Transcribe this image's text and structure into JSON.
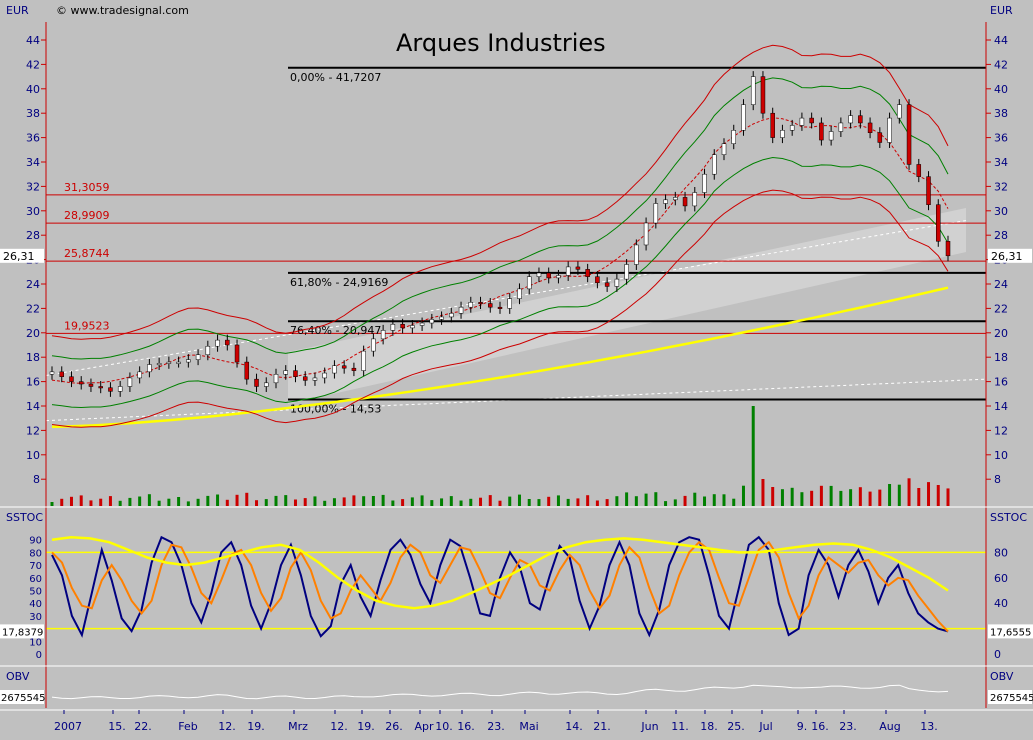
{
  "header": {
    "currency_left": "EUR",
    "currency_right": "EUR",
    "source": "© www.tradesignal.com",
    "title": "Arques Industries"
  },
  "colors": {
    "background": "#c0c0c0",
    "price_axis_line": "#cc0000",
    "fib_line": "#000000",
    "retrace_line": "#cc0000",
    "candle_up": "#ffffff",
    "candle_down": "#cc0000",
    "volume_up": "#008000",
    "volume_down": "#cc0000",
    "bollinger_outer": "#cc0000",
    "bollinger_inner": "#008000",
    "moving_average": "#ffff00",
    "stoch_fast": "#000080",
    "stoch_slow": "#ff8000",
    "obv": "#ffffff"
  },
  "chart_data": [
    {
      "panel": "price",
      "type": "candlestick",
      "title": "Arques Industries",
      "ylabel": "EUR",
      "ylim": [
        6,
        46
      ],
      "y_ticks": [
        8,
        10,
        12,
        14,
        16,
        18,
        20,
        22,
        24,
        26,
        28,
        30,
        32,
        34,
        36,
        38,
        40,
        42,
        44
      ],
      "grid": false,
      "last_price": "26,31",
      "x_labels": [
        "2007",
        "15.",
        "22.",
        "Feb",
        "12.",
        "19.",
        "Mrz",
        "12.",
        "19.",
        "26.",
        "Apr",
        "10.",
        "16.",
        "23.",
        "Mai",
        "14.",
        "21.",
        "Jun",
        "11.",
        "18.",
        "25.",
        "Jul",
        "9.",
        "16.",
        "23.",
        "Aug",
        "13."
      ],
      "fibonacci_levels": [
        {
          "label": "0,00% - 41,7207",
          "value": 41.7207
        },
        {
          "label": "61,80% - 24,9169",
          "value": 24.9169
        },
        {
          "label": "76,40% - 20,947",
          "value": 20.947
        },
        {
          "label": "100,00% - 14,53",
          "value": 14.53
        }
      ],
      "horizontal_levels": [
        {
          "label": "31,3059",
          "value": 31.3059
        },
        {
          "label": "28,9909",
          "value": 28.9909
        },
        {
          "label": "25,8744",
          "value": 25.8744
        },
        {
          "label": "19,9523",
          "value": 19.9523
        }
      ],
      "close_series_approx": [
        16.8,
        16.4,
        16.0,
        15.8,
        15.6,
        15.5,
        15.2,
        15.6,
        16.3,
        16.8,
        17.4,
        17.5,
        17.6,
        17.6,
        17.8,
        18.2,
        18.9,
        19.4,
        19.0,
        17.6,
        16.2,
        15.6,
        15.9,
        16.6,
        16.9,
        16.4,
        16.1,
        16.3,
        16.7,
        17.3,
        17.1,
        16.9,
        18.5,
        19.5,
        20.2,
        20.7,
        20.4,
        20.6,
        20.8,
        21.1,
        21.3,
        21.6,
        22.1,
        22.5,
        22.4,
        22.1,
        22.0,
        22.8,
        23.6,
        24.6,
        24.9,
        24.5,
        24.7,
        25.4,
        25.2,
        24.6,
        24.1,
        23.8,
        24.4,
        25.6,
        27.2,
        29.0,
        30.6,
        30.9,
        31.1,
        30.4,
        31.5,
        33.0,
        34.6,
        35.5,
        36.6,
        38.7,
        41.0,
        38.0,
        36.0,
        36.6,
        37.0,
        37.6,
        37.2,
        35.8,
        36.5,
        37.2,
        37.8,
        37.2,
        36.4,
        35.6,
        37.6,
        38.7,
        33.8,
        32.8,
        30.5,
        27.5,
        26.31
      ],
      "moving_average_range": [
        12.3,
        23.7
      ],
      "bollinger_width_approx": 3.2,
      "volume_axis": [
        8,
        10,
        12,
        14
      ]
    },
    {
      "panel": "stochastic",
      "type": "line",
      "label": "SSTOC",
      "ylim": [
        0,
        100
      ],
      "y_ticks_left": [
        0,
        10,
        20,
        30,
        40,
        50,
        60,
        70,
        80,
        90
      ],
      "y_ticks_right": [
        0,
        20,
        40,
        60,
        80
      ],
      "levels": [
        20,
        80
      ],
      "value_left": "17,8379",
      "value_right": "17,6555",
      "series": [
        {
          "name": "",
          "values": [
            78,
            62,
            30,
            15,
            48,
            82,
            58,
            28,
            18,
            35,
            72,
            92,
            88,
            70,
            40,
            25,
            48,
            80,
            88,
            70,
            38,
            20,
            40,
            70,
            86,
            62,
            30,
            14,
            22,
            55,
            70,
            45,
            30,
            58,
            82,
            90,
            78,
            55,
            40,
            70,
            90,
            85,
            60,
            32,
            30,
            60,
            80,
            68,
            40,
            35,
            62,
            85,
            76,
            42,
            20,
            38,
            70,
            88,
            70,
            32,
            15,
            35,
            70,
            88,
            92,
            90,
            62,
            30,
            20,
            52,
            86,
            92,
            82,
            40,
            15,
            20,
            62,
            82,
            70,
            45,
            70,
            82,
            65,
            40,
            60,
            70,
            48,
            32,
            25,
            20,
            17.8
          ]
        },
        {
          "name": "",
          "values": [
            80,
            72,
            52,
            38,
            36,
            58,
            70,
            58,
            42,
            32,
            42,
            70,
            86,
            84,
            68,
            48,
            40,
            58,
            78,
            82,
            70,
            48,
            34,
            44,
            68,
            80,
            66,
            42,
            28,
            32,
            50,
            62,
            52,
            42,
            56,
            76,
            86,
            80,
            62,
            56,
            70,
            84,
            82,
            66,
            48,
            44,
            60,
            74,
            70,
            54,
            50,
            66,
            78,
            70,
            50,
            36,
            46,
            70,
            84,
            76,
            52,
            32,
            38,
            62,
            80,
            88,
            82,
            60,
            40,
            38,
            60,
            82,
            88,
            76,
            48,
            28,
            38,
            62,
            76,
            70,
            64,
            72,
            74,
            62,
            54,
            60,
            58,
            46,
            36,
            26,
            17.6
          ]
        },
        {
          "name": "",
          "values": [
            90,
            92,
            91,
            88,
            82,
            76,
            72,
            70,
            72,
            76,
            80,
            84,
            86,
            82,
            72,
            60,
            50,
            42,
            38,
            36,
            38,
            42,
            48,
            55,
            62,
            70,
            78,
            84,
            88,
            90,
            91,
            90,
            88,
            86,
            84,
            82,
            80,
            80,
            82,
            84,
            86,
            87,
            86,
            82,
            76,
            68,
            60,
            50
          ]
        }
      ]
    },
    {
      "panel": "obv",
      "type": "line",
      "label": "OBV",
      "value_left": "2675545",
      "value_right": "2675545"
    }
  ]
}
